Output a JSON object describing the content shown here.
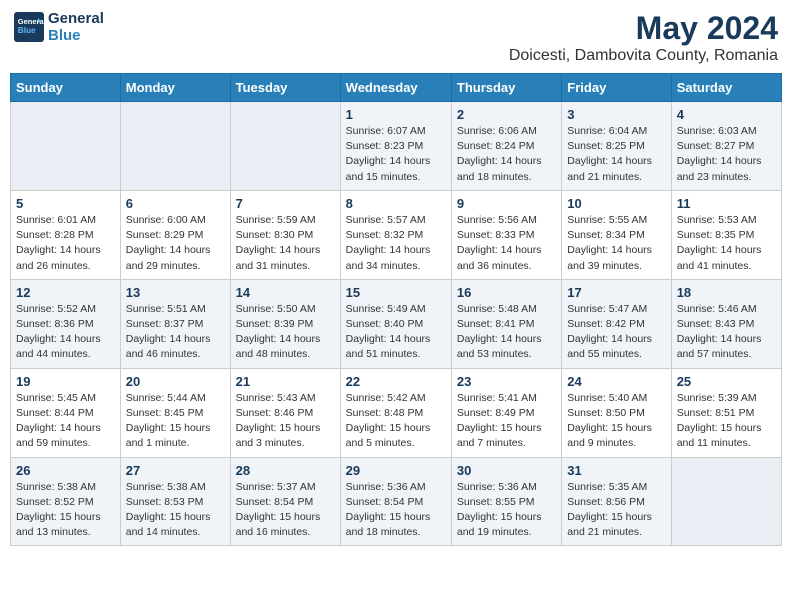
{
  "header": {
    "logo_line1": "General",
    "logo_line2": "Blue",
    "main_title": "May 2024",
    "subtitle": "Doicesti, Dambovita County, Romania"
  },
  "weekdays": [
    "Sunday",
    "Monday",
    "Tuesday",
    "Wednesday",
    "Thursday",
    "Friday",
    "Saturday"
  ],
  "weeks": [
    [
      {
        "day": "",
        "info": ""
      },
      {
        "day": "",
        "info": ""
      },
      {
        "day": "",
        "info": ""
      },
      {
        "day": "1",
        "info": "Sunrise: 6:07 AM\nSunset: 8:23 PM\nDaylight: 14 hours\nand 15 minutes."
      },
      {
        "day": "2",
        "info": "Sunrise: 6:06 AM\nSunset: 8:24 PM\nDaylight: 14 hours\nand 18 minutes."
      },
      {
        "day": "3",
        "info": "Sunrise: 6:04 AM\nSunset: 8:25 PM\nDaylight: 14 hours\nand 21 minutes."
      },
      {
        "day": "4",
        "info": "Sunrise: 6:03 AM\nSunset: 8:27 PM\nDaylight: 14 hours\nand 23 minutes."
      }
    ],
    [
      {
        "day": "5",
        "info": "Sunrise: 6:01 AM\nSunset: 8:28 PM\nDaylight: 14 hours\nand 26 minutes."
      },
      {
        "day": "6",
        "info": "Sunrise: 6:00 AM\nSunset: 8:29 PM\nDaylight: 14 hours\nand 29 minutes."
      },
      {
        "day": "7",
        "info": "Sunrise: 5:59 AM\nSunset: 8:30 PM\nDaylight: 14 hours\nand 31 minutes."
      },
      {
        "day": "8",
        "info": "Sunrise: 5:57 AM\nSunset: 8:32 PM\nDaylight: 14 hours\nand 34 minutes."
      },
      {
        "day": "9",
        "info": "Sunrise: 5:56 AM\nSunset: 8:33 PM\nDaylight: 14 hours\nand 36 minutes."
      },
      {
        "day": "10",
        "info": "Sunrise: 5:55 AM\nSunset: 8:34 PM\nDaylight: 14 hours\nand 39 minutes."
      },
      {
        "day": "11",
        "info": "Sunrise: 5:53 AM\nSunset: 8:35 PM\nDaylight: 14 hours\nand 41 minutes."
      }
    ],
    [
      {
        "day": "12",
        "info": "Sunrise: 5:52 AM\nSunset: 8:36 PM\nDaylight: 14 hours\nand 44 minutes."
      },
      {
        "day": "13",
        "info": "Sunrise: 5:51 AM\nSunset: 8:37 PM\nDaylight: 14 hours\nand 46 minutes."
      },
      {
        "day": "14",
        "info": "Sunrise: 5:50 AM\nSunset: 8:39 PM\nDaylight: 14 hours\nand 48 minutes."
      },
      {
        "day": "15",
        "info": "Sunrise: 5:49 AM\nSunset: 8:40 PM\nDaylight: 14 hours\nand 51 minutes."
      },
      {
        "day": "16",
        "info": "Sunrise: 5:48 AM\nSunset: 8:41 PM\nDaylight: 14 hours\nand 53 minutes."
      },
      {
        "day": "17",
        "info": "Sunrise: 5:47 AM\nSunset: 8:42 PM\nDaylight: 14 hours\nand 55 minutes."
      },
      {
        "day": "18",
        "info": "Sunrise: 5:46 AM\nSunset: 8:43 PM\nDaylight: 14 hours\nand 57 minutes."
      }
    ],
    [
      {
        "day": "19",
        "info": "Sunrise: 5:45 AM\nSunset: 8:44 PM\nDaylight: 14 hours\nand 59 minutes."
      },
      {
        "day": "20",
        "info": "Sunrise: 5:44 AM\nSunset: 8:45 PM\nDaylight: 15 hours\nand 1 minute."
      },
      {
        "day": "21",
        "info": "Sunrise: 5:43 AM\nSunset: 8:46 PM\nDaylight: 15 hours\nand 3 minutes."
      },
      {
        "day": "22",
        "info": "Sunrise: 5:42 AM\nSunset: 8:48 PM\nDaylight: 15 hours\nand 5 minutes."
      },
      {
        "day": "23",
        "info": "Sunrise: 5:41 AM\nSunset: 8:49 PM\nDaylight: 15 hours\nand 7 minutes."
      },
      {
        "day": "24",
        "info": "Sunrise: 5:40 AM\nSunset: 8:50 PM\nDaylight: 15 hours\nand 9 minutes."
      },
      {
        "day": "25",
        "info": "Sunrise: 5:39 AM\nSunset: 8:51 PM\nDaylight: 15 hours\nand 11 minutes."
      }
    ],
    [
      {
        "day": "26",
        "info": "Sunrise: 5:38 AM\nSunset: 8:52 PM\nDaylight: 15 hours\nand 13 minutes."
      },
      {
        "day": "27",
        "info": "Sunrise: 5:38 AM\nSunset: 8:53 PM\nDaylight: 15 hours\nand 14 minutes."
      },
      {
        "day": "28",
        "info": "Sunrise: 5:37 AM\nSunset: 8:54 PM\nDaylight: 15 hours\nand 16 minutes."
      },
      {
        "day": "29",
        "info": "Sunrise: 5:36 AM\nSunset: 8:54 PM\nDaylight: 15 hours\nand 18 minutes."
      },
      {
        "day": "30",
        "info": "Sunrise: 5:36 AM\nSunset: 8:55 PM\nDaylight: 15 hours\nand 19 minutes."
      },
      {
        "day": "31",
        "info": "Sunrise: 5:35 AM\nSunset: 8:56 PM\nDaylight: 15 hours\nand 21 minutes."
      },
      {
        "day": "",
        "info": ""
      }
    ]
  ]
}
